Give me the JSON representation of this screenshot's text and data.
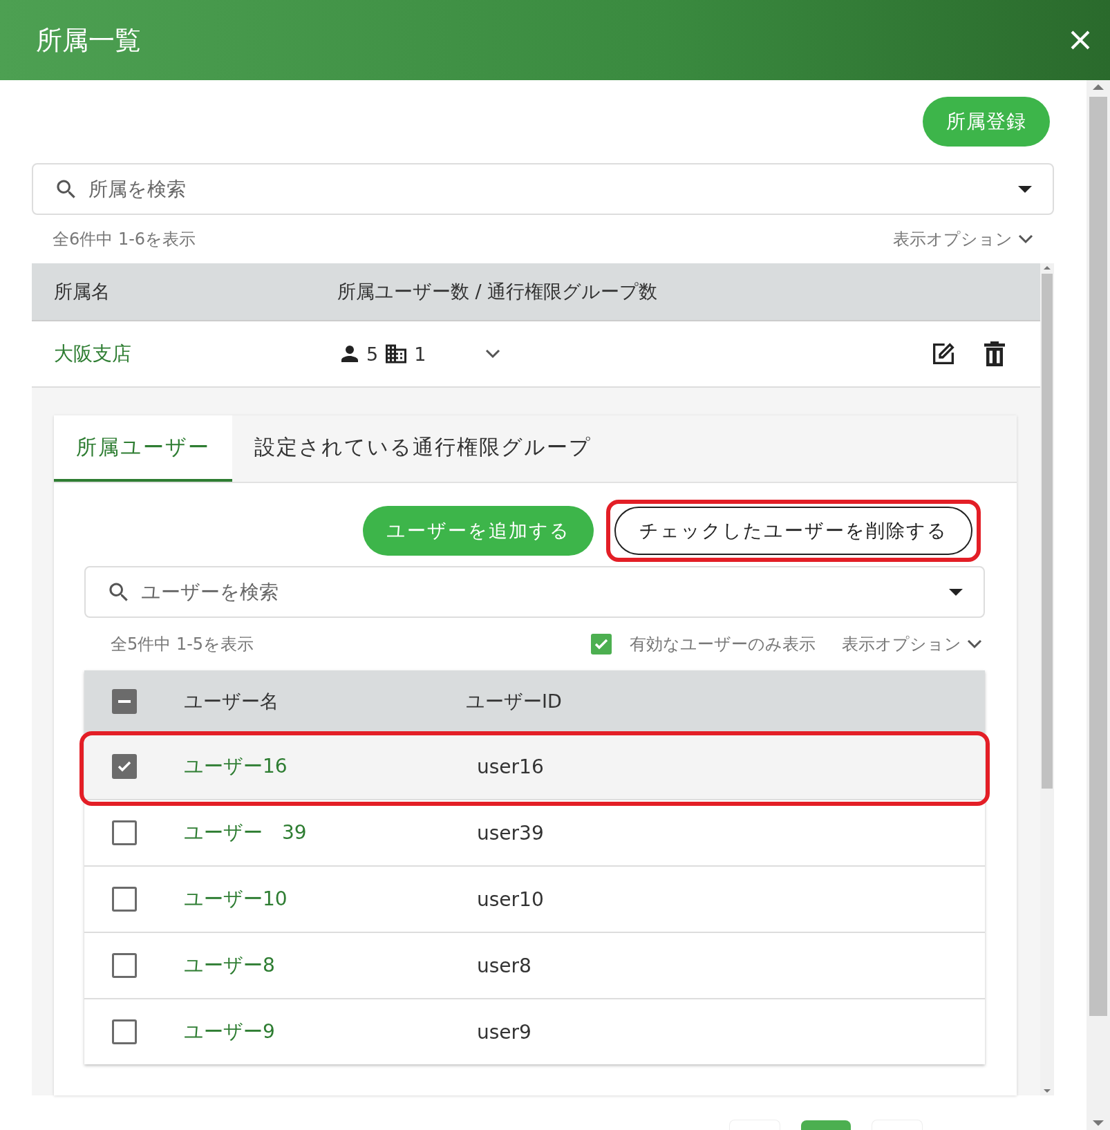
{
  "dialog": {
    "title": "所属一覧"
  },
  "register_button": "所属登録",
  "search": {
    "placeholder": "所属を検索"
  },
  "count": "全6件中 1-6を表示",
  "options": "表示オプション",
  "table": {
    "columns": [
      "所属名",
      "所属ユーザー数 / 通行権限グループ数"
    ],
    "rows": [
      {
        "name": "大阪支店",
        "users": "5",
        "groups": "1",
        "expanded": true
      }
    ]
  },
  "tabs": [
    {
      "label": "所属ユーザー",
      "selected": true
    },
    {
      "label": "設定されている通行権限グループ",
      "selected": false
    }
  ],
  "add_button": "ユーザーを追加する",
  "delete_button": {
    "label": "チェックしたユーザーを削除する",
    "highlighted": true
  },
  "user_search": {
    "placeholder": "ユーザーを検索"
  },
  "user_count": "全5件中 1-5を表示",
  "active_only": {
    "label": "有効なユーザーのみ表示",
    "checked": true
  },
  "user_options": "表示オプション",
  "user_table": {
    "columns": [
      "ユーザー名",
      "ユーザーID"
    ],
    "select_all": {
      "indeterminate": true
    },
    "rows": [
      {
        "name": "ユーザー16",
        "id": "user16",
        "checked": true,
        "highlighted": true
      },
      {
        "name": "ユーザー　39",
        "id": "user39",
        "checked": false,
        "highlighted": false
      },
      {
        "name": "ユーザー10",
        "id": "user10",
        "checked": false,
        "highlighted": false
      },
      {
        "name": "ユーザー8",
        "id": "user8",
        "checked": false,
        "highlighted": false
      },
      {
        "name": "ユーザー9",
        "id": "user9",
        "checked": false,
        "highlighted": false
      }
    ]
  }
}
